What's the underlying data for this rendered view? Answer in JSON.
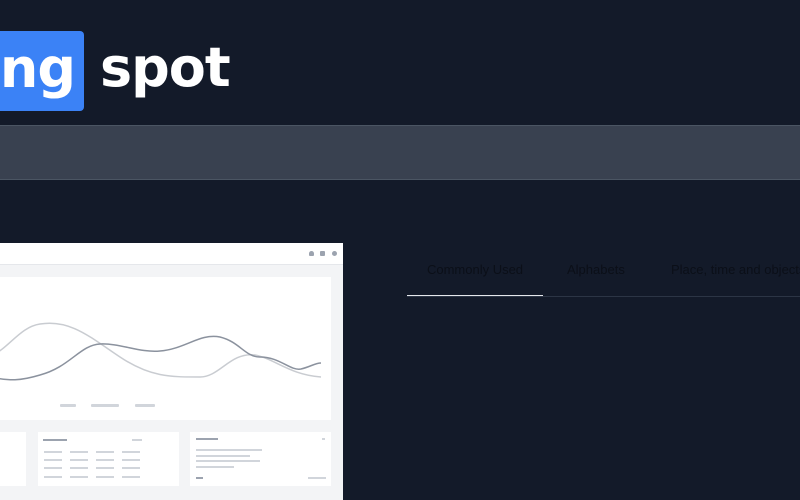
{
  "logo": {
    "box_text": "ing",
    "word": "spot",
    "brand_color": "#3b82f6"
  },
  "colors": {
    "background": "#131a29",
    "nav_band": "#394150"
  },
  "preview": {
    "description_icon_names": [
      "bell-icon",
      "grid-icon",
      "user-icon"
    ]
  },
  "tabs": [
    {
      "label": "Commonly Used",
      "active": true
    },
    {
      "label": "Alphabets",
      "active": false
    },
    {
      "label": "Place, time and objects",
      "active": false
    }
  ]
}
